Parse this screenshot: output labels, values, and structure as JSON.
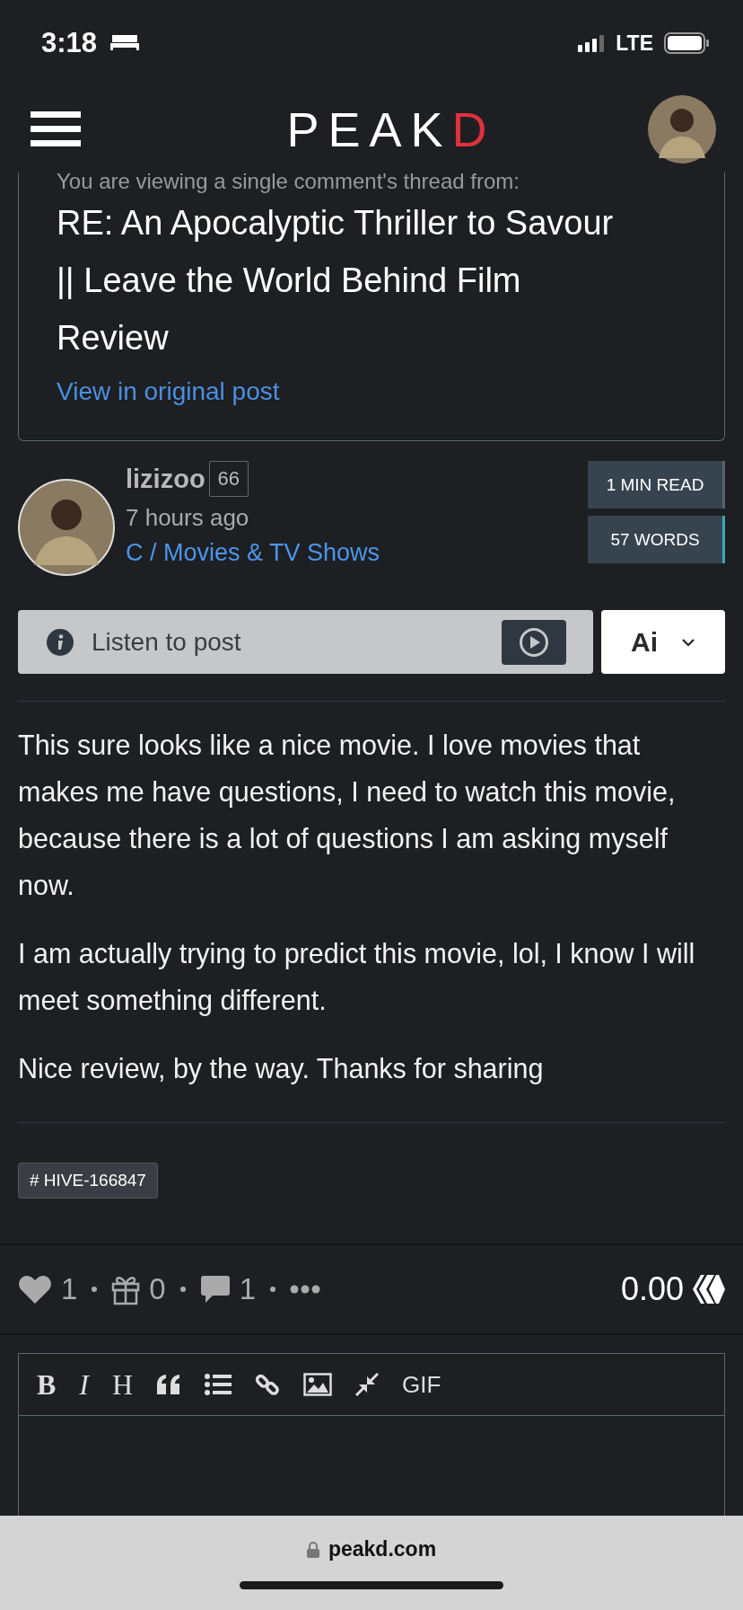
{
  "status_bar": {
    "time": "3:18",
    "network": "LTE"
  },
  "header": {
    "logo": "PEAKD"
  },
  "thread_notice": {
    "intro": "You are viewing a single comment's thread from:",
    "title": "RE: An Apocalyptic Thriller to Savour || Leave the World Behind Film Review",
    "link": "View in original post"
  },
  "author": {
    "name": "lizizoo",
    "reputation": "66",
    "time": "7 hours ago",
    "community": "C / Movies & TV Shows"
  },
  "stats": [
    {
      "label": "1 MIN READ",
      "color": "#56626d"
    },
    {
      "label": "57 WORDS",
      "color": "#3ba6bf"
    }
  ],
  "listen": {
    "label": "Listen to post"
  },
  "ai_menu": {
    "label": "Ai"
  },
  "body": [
    "This sure looks like a nice movie. I love movies that makes me have questions, I need to watch this movie, because there is a lot of questions I am asking myself now.",
    "I am actually trying to predict this movie, lol, I know I will meet something different.",
    "Nice review, by the way. Thanks for sharing"
  ],
  "tags": [
    "# HIVE-166847"
  ],
  "actions": {
    "votes": "1",
    "gifts": "0",
    "comments": "1",
    "payout": "0.00"
  },
  "editor_toolbar": {
    "text_buttons": [
      "B",
      "I",
      "H"
    ],
    "gif": "GIF"
  },
  "browser_bar": {
    "url": "peakd.com"
  }
}
